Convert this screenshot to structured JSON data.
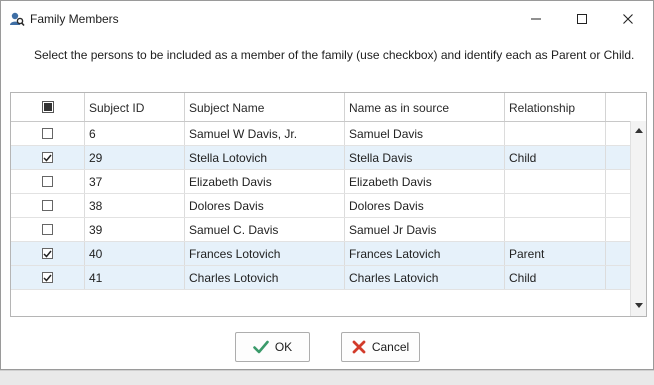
{
  "window": {
    "title": "Family Members"
  },
  "instruction": "Select the persons to be included as a member of the family (use checkbox) and identify each as Parent or Child.",
  "grid": {
    "columns": [
      "Subject ID",
      "Subject Name",
      "Name as in source",
      "Relationship"
    ],
    "rows": [
      {
        "checked": false,
        "id": "6",
        "name": "Samuel W Davis, Jr.",
        "source": "Samuel Davis",
        "relationship": ""
      },
      {
        "checked": true,
        "id": "29",
        "name": "Stella Lotovich",
        "source": "Stella Davis",
        "relationship": "Child"
      },
      {
        "checked": false,
        "id": "37",
        "name": "Elizabeth Davis",
        "source": "Elizabeth Davis",
        "relationship": ""
      },
      {
        "checked": false,
        "id": "38",
        "name": "Dolores Davis",
        "source": "Dolores Davis",
        "relationship": ""
      },
      {
        "checked": false,
        "id": "39",
        "name": "Samuel C. Davis",
        "source": "Samuel Jr Davis",
        "relationship": ""
      },
      {
        "checked": true,
        "id": "40",
        "name": "Frances Lotovich",
        "source": "Frances Latovich",
        "relationship": "Parent"
      },
      {
        "checked": true,
        "id": "41",
        "name": "Charles Lotovich",
        "source": "Charles Latovich",
        "relationship": "Child"
      }
    ]
  },
  "buttons": {
    "ok": "OK",
    "cancel": "Cancel"
  },
  "colors": {
    "selected_row": "#e6f1fa",
    "ok_icon": "#3a9a6a",
    "cancel_icon": "#d23a2a"
  },
  "icons": {
    "app": "person-search-icon",
    "ok": "check-icon",
    "cancel": "x-icon"
  }
}
